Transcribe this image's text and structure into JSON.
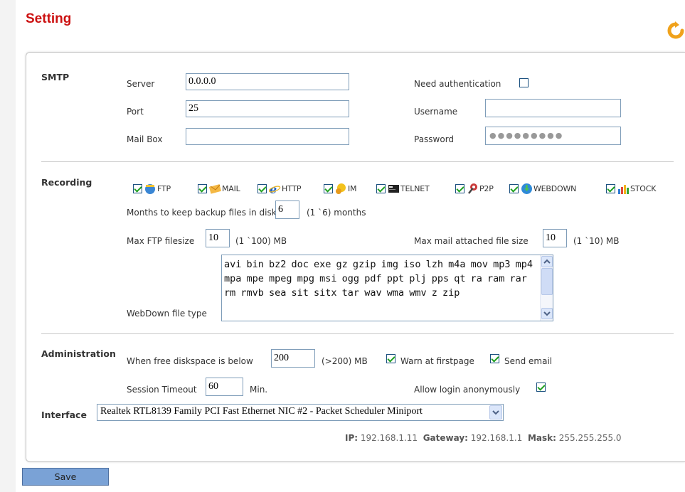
{
  "page": {
    "title": "Setting"
  },
  "icons": {
    "refresh": "refresh-icon",
    "checkbox_checked": "check-mark"
  },
  "colors": {
    "title": "#cc1111",
    "save_button": "#7aa2d6",
    "check": "#21a121"
  },
  "smtp": {
    "section_label": "SMTP",
    "server_label": "Server",
    "server_value": "0.0.0.0",
    "port_label": "Port",
    "port_value": "25",
    "mailbox_label": "Mail Box",
    "mailbox_value": "",
    "auth_label": "Need authentication",
    "auth_checked": false,
    "username_label": "Username",
    "username_value": "",
    "password_label": "Password",
    "password_mask": "●●●●●●●●●"
  },
  "recording": {
    "section_label": "Recording",
    "protocols": [
      {
        "label": "FTP",
        "checked": true,
        "icon": "ftp-icon"
      },
      {
        "label": "MAIL",
        "checked": true,
        "icon": "mail-icon"
      },
      {
        "label": "HTTP",
        "checked": true,
        "icon": "http-icon"
      },
      {
        "label": "IM",
        "checked": true,
        "icon": "im-icon"
      },
      {
        "label": "TELNET",
        "checked": true,
        "icon": "telnet-icon"
      },
      {
        "label": "P2P",
        "checked": true,
        "icon": "p2p-icon"
      },
      {
        "label": "WEBDOWN",
        "checked": true,
        "icon": "webdown-icon"
      },
      {
        "label": "STOCK",
        "checked": true,
        "icon": "stock-icon"
      }
    ],
    "months_label": "Months to keep backup files in disk",
    "months_value": "6",
    "months_range": "(1 `6) months",
    "ftp_label": "Max FTP filesize",
    "ftp_value": "10",
    "ftp_range": "(1 `100)  MB",
    "mail_label": "Max mail attached file size",
    "mail_value": "10",
    "mail_range": "(1 `10)  MB",
    "webdown_label": "WebDown file type",
    "webdown_types": "avi bin bz2 doc exe gz gzip img iso lzh m4a mov mp3 mp4 mpa mpe mpeg mpg msi ogg pdf ppt plj pps qt ra ram rar rm rmvb sea sit sitx tar wav wma wmv z zip"
  },
  "administration": {
    "section_label": "Administration",
    "diskspace_label": "When free diskspace is below",
    "diskspace_value": "200",
    "diskspace_range": "(>200)  MB",
    "warn_label": "Warn at firstpage",
    "warn_checked": true,
    "email_label": "Send email",
    "email_checked": true,
    "timeout_label": "Session Timeout",
    "timeout_value": "60",
    "timeout_unit": "Min.",
    "anon_label": "Allow login anonymously",
    "anon_checked": true
  },
  "interface": {
    "section_label": "Interface",
    "selected": "Realtek RTL8139 Family PCI Fast Ethernet NIC #2 - Packet Scheduler Miniport",
    "ip_label": "IP:",
    "ip_value": "192.168.1.11",
    "gateway_label": "Gateway:",
    "gateway_value": "192.168.1.1",
    "mask_label": "Mask:",
    "mask_value": "255.255.255.0"
  },
  "actions": {
    "save_label": "Save"
  }
}
